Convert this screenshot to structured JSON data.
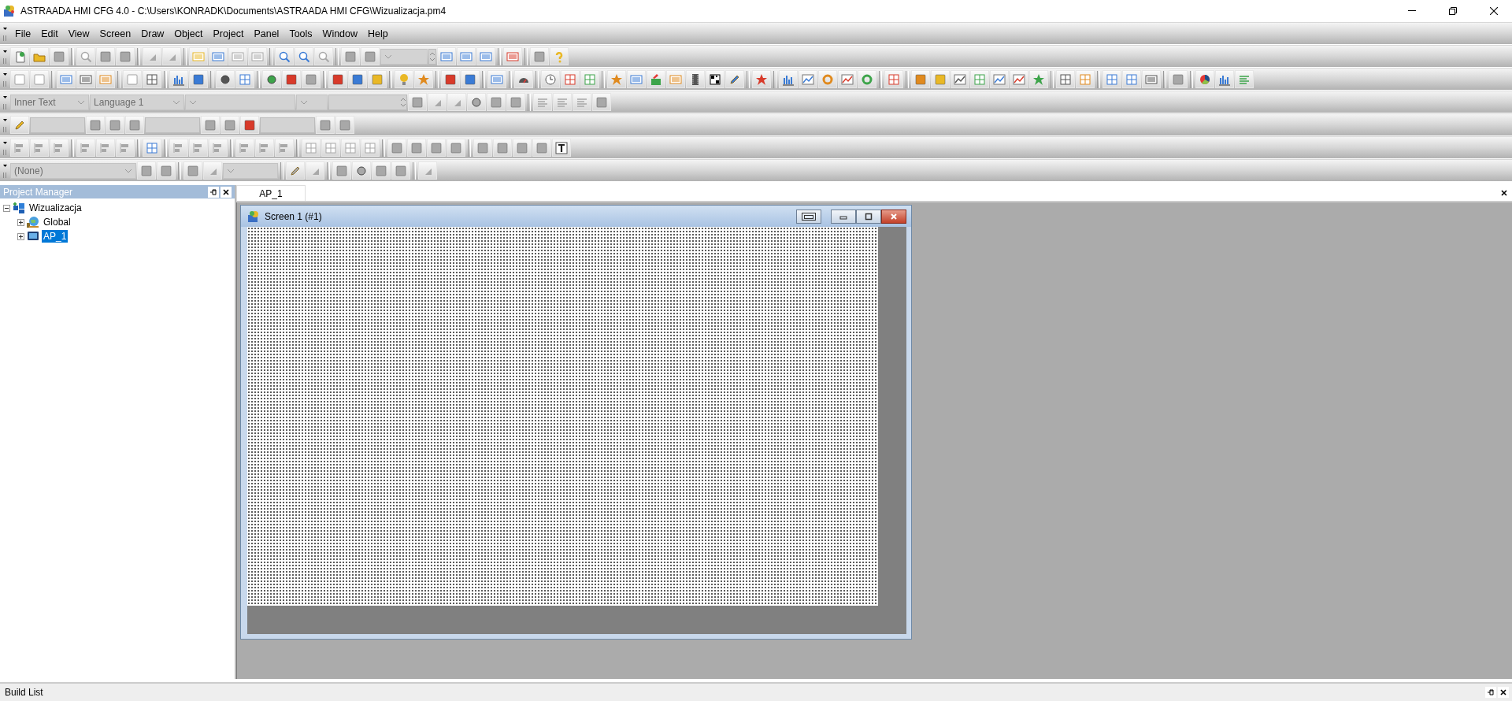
{
  "window": {
    "title": "ASTRAADA HMI CFG 4.0 - C:\\Users\\KONRADK\\Documents\\ASTRAADA HMI CFG\\Wizualizacja.pm4"
  },
  "menu": [
    {
      "label": "File"
    },
    {
      "label": "Edit"
    },
    {
      "label": "View"
    },
    {
      "label": "Screen"
    },
    {
      "label": "Draw"
    },
    {
      "label": "Object"
    },
    {
      "label": "Project"
    },
    {
      "label": "Panel"
    },
    {
      "label": "Tools"
    },
    {
      "label": "Window"
    },
    {
      "label": "Help"
    }
  ],
  "format_toolbar": {
    "text_mode": "Inner Text",
    "language": "Language 1"
  },
  "style_toolbar": {
    "line_style": "(None)"
  },
  "project_manager": {
    "title": "Project Manager",
    "tree": [
      {
        "label": "Wizualizacja",
        "kind": "project",
        "expanded": true,
        "selected": false,
        "children": [
          {
            "label": "Global",
            "kind": "global",
            "expanded": false,
            "selected": false
          },
          {
            "label": "AP_1",
            "kind": "panel",
            "expanded": false,
            "selected": true
          }
        ]
      }
    ]
  },
  "tabs": [
    {
      "label": "AP_1",
      "selected": true
    }
  ],
  "screen_window": {
    "title": "Screen 1 (#1)"
  },
  "build_list": {
    "title": "Build List"
  }
}
